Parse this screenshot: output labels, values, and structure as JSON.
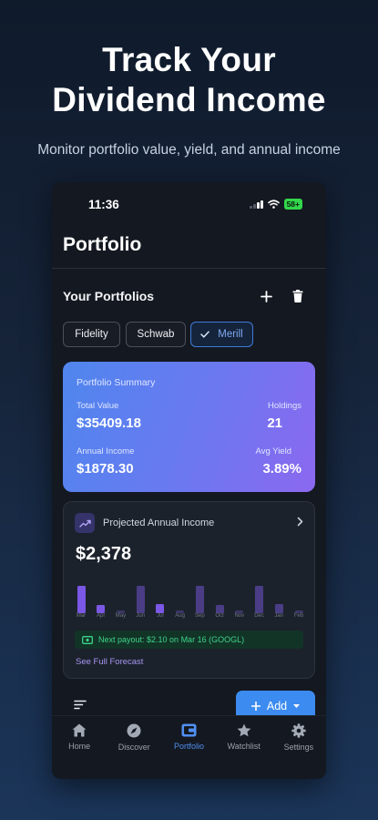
{
  "hero": {
    "title_line1": "Track Your",
    "title_line2": "Dividend Income",
    "subtitle": "Monitor portfolio value, yield, and annual income"
  },
  "status_bar": {
    "time": "11:36",
    "battery": "58+"
  },
  "header": {
    "title": "Portfolio"
  },
  "portfolios": {
    "section_title": "Your Portfolios",
    "add_icon": "plus-icon",
    "delete_icon": "trash-icon",
    "chips": [
      {
        "label": "Fidelity",
        "selected": false
      },
      {
        "label": "Schwab",
        "selected": false
      },
      {
        "label": "Merill",
        "selected": true
      }
    ]
  },
  "summary": {
    "title": "Portfolio Summary",
    "total_value_label": "Total Value",
    "total_value": "$35409.18",
    "holdings_label": "Holdings",
    "holdings": "21",
    "annual_income_label": "Annual Income",
    "annual_income": "$1878.30",
    "avg_yield_label": "Avg Yield",
    "avg_yield": "3.89%"
  },
  "projected": {
    "title": "Projected Annual Income",
    "amount": "$2,378",
    "months": [
      "Mar",
      "Apr",
      "May",
      "Jun",
      "Jul",
      "Aug",
      "Sep",
      "Oct",
      "Nov",
      "Dec",
      "Jan",
      "Feb"
    ],
    "bar_levels": [
      1.0,
      0.3,
      0.1,
      1.0,
      0.33,
      0.1,
      1.0,
      0.3,
      0.1,
      1.0,
      0.33,
      0.1
    ],
    "payout_text": "Next payout: $2.10 on Mar 16  (GOOGL)",
    "forecast_link": "See Full Forecast"
  },
  "actions": {
    "add_label": "Add"
  },
  "tabs": [
    {
      "label": "Home",
      "icon": "home-icon",
      "active": false
    },
    {
      "label": "Discover",
      "icon": "compass-icon",
      "active": false
    },
    {
      "label": "Portfolio",
      "icon": "wallet-icon",
      "active": true
    },
    {
      "label": "Watchlist",
      "icon": "star-icon",
      "active": false
    },
    {
      "label": "Settings",
      "icon": "gear-icon",
      "active": false
    }
  ],
  "colors": {
    "accent": "#3c8bf0",
    "bar_strong": "#7b57e6",
    "bar_faint": "#3e3770",
    "payout_green": "#3fd389"
  }
}
